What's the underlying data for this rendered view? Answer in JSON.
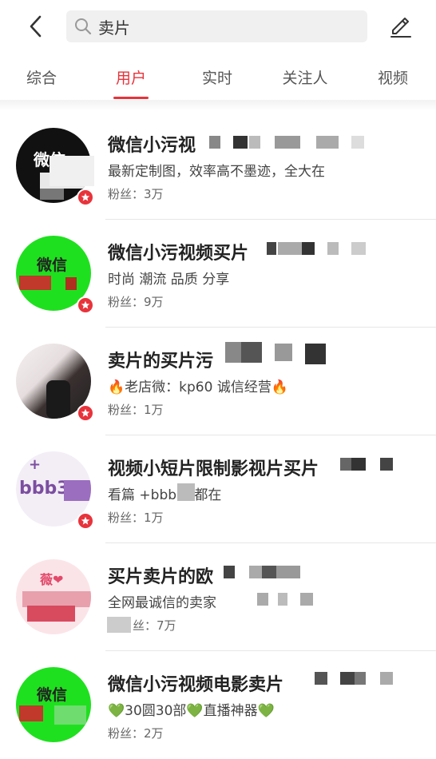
{
  "search": {
    "query": "卖片"
  },
  "tabs": [
    {
      "label": "综合"
    },
    {
      "label": "用户"
    },
    {
      "label": "实时"
    },
    {
      "label": "关注人"
    },
    {
      "label": "视频"
    }
  ],
  "users": [
    {
      "name": "微信小污视",
      "desc": "最新定制图，效率高不墨迹，全大在",
      "fans": "粉丝：3万",
      "avatar_text": "微信"
    },
    {
      "name": "微信小污视频买片",
      "desc": "时尚 潮流  品质  分享",
      "fans": "粉丝：9万",
      "avatar_text": "微信"
    },
    {
      "name": "卖片的买片污",
      "desc": "🔥老店微：kp60    诚信经营🔥",
      "fans": "粉丝：1万",
      "avatar_text": ""
    },
    {
      "name": "视频小短片限制影视片买片",
      "desc": "看篇 +bbb        天都在",
      "fans": "粉丝：1万",
      "avatar_text": "bbb3"
    },
    {
      "name": "买片卖片的欧",
      "desc": "全网最诚信的卖家",
      "fans": "丝：7万",
      "avatar_text": "薇❤"
    },
    {
      "name": "微信小污视频电影卖片",
      "desc": "💚30圆30部💚直播神器💚",
      "fans": "粉丝：2万",
      "avatar_text": "微信"
    }
  ],
  "colors": {
    "accent": "#e8333b",
    "green_avatar": "#1fe01f"
  }
}
